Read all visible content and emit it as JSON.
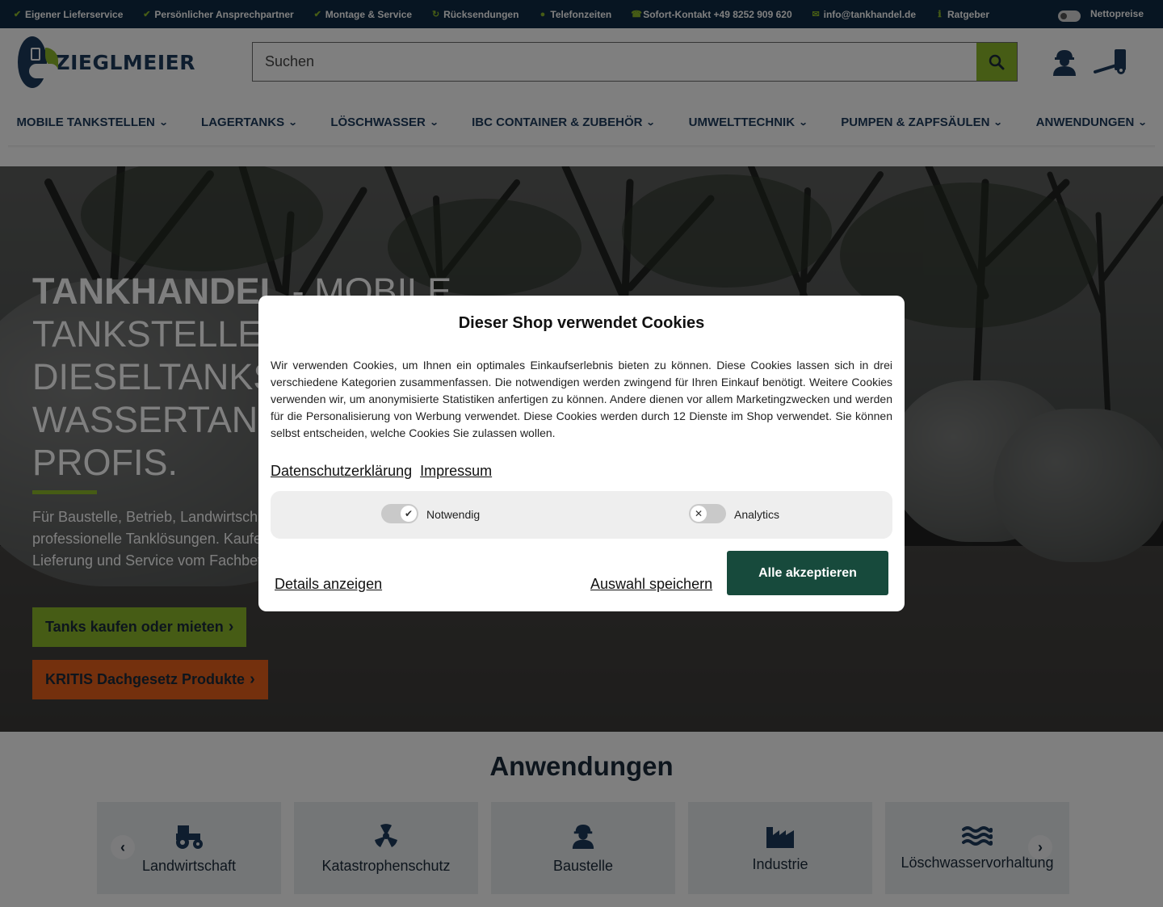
{
  "topbar": {
    "items": [
      {
        "icon": "check-circle-icon",
        "label": "Eigener Lieferservice"
      },
      {
        "icon": "check-circle-icon",
        "label": "Persönlicher Ansprechpartner"
      },
      {
        "icon": "check-circle-icon",
        "label": "Montage & Service"
      },
      {
        "icon": "return-icon",
        "label": "Rücksendungen"
      },
      {
        "icon": "clock-icon",
        "label": "Telefonzeiten"
      },
      {
        "icon": "phone-icon",
        "label": "Sofort-Kontakt +49 8252 909 620"
      },
      {
        "icon": "mail-icon",
        "label": "info@tankhandel.de"
      },
      {
        "icon": "info-icon",
        "label": "Ratgeber"
      }
    ],
    "netto_label": "Nettopreise"
  },
  "header": {
    "logo_text": "ZIEGLMEIER",
    "search_placeholder": "Suchen"
  },
  "nav": {
    "items": [
      "MOBILE TANKSTELLEN",
      "LAGERTANKS",
      "LÖSCHWASSER",
      "IBC CONTAINER & ZUBEHÖR",
      "UMWELTTECHNIK",
      "PUMPEN & ZAPFSÄULEN",
      "ANWENDUNGEN"
    ]
  },
  "hero": {
    "title_bold": "TANKHANDEL",
    "title_rest": " - MOBILE TANKSTELLEN, DIESELTANKS UND WASSERTANKS VOM PROFIS.",
    "text": "Für Baustelle, Betrieb, Landwirtschaft und Löschwasser: professionelle Tanklösungen. Kaufen & Mieten - mit Beratung, Lieferung und Service vom Fachbetrieb.",
    "cta_primary": "Tanks kaufen oder mieten",
    "cta_secondary": "KRITIS Dachgesetz Produkte"
  },
  "apps": {
    "title": "Anwendungen",
    "tiles": [
      {
        "icon": "tractor-icon",
        "label": "Landwirtschaft"
      },
      {
        "icon": "radiation-icon",
        "label": "Katastrophenschutz"
      },
      {
        "icon": "construction-worker-icon",
        "label": "Baustelle"
      },
      {
        "icon": "factory-icon",
        "label": "Industrie"
      },
      {
        "icon": "water-waves-icon",
        "label": "Löschwasservorhaltung"
      }
    ]
  },
  "cookie": {
    "title": "Dieser Shop verwendet Cookies",
    "body": "Wir verwenden Cookies, um Ihnen ein optimales Einkaufserlebnis bieten zu können. Diese Cookies lassen sich in drei verschiedene Kategorien zusammenfassen. Die notwendigen werden zwingend für Ihren Einkauf benötigt. Weitere Cookies verwenden wir, um anonymisierte Statistiken anfertigen zu können. Andere dienen vor allem Marketingzwecken und werden für die Personalisierung von Werbung verwendet. Diese Cookies werden durch 12 Dienste im Shop verwendet. Sie können selbst entscheiden, welche Cookies Sie zulassen wollen.",
    "link_privacy": "Datenschutzerklärung",
    "link_imprint": "Impressum",
    "categories": [
      {
        "label": "Notwendig",
        "enabled": true
      },
      {
        "label": "Analytics",
        "enabled": false
      }
    ],
    "details_label": "Details anzeigen",
    "save_label": "Auswahl speichern",
    "accept_label": "Alle akzeptieren"
  },
  "colors": {
    "topbar_bg": "#0f2a44",
    "accent_green": "#8cb82b",
    "accent_orange": "#e8611a",
    "brand_navy": "#1d3b5c",
    "accept_button": "#174a3c"
  }
}
